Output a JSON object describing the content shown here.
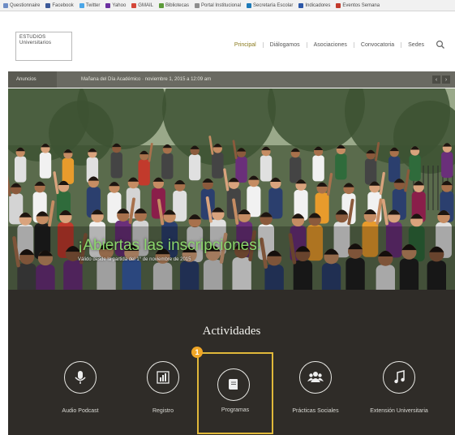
{
  "bookmarks": [
    {
      "label": "Questionnaire",
      "color": "#6d8cc4"
    },
    {
      "label": "Facebook",
      "color": "#3b5998"
    },
    {
      "label": "Twitter",
      "color": "#4aa6e8"
    },
    {
      "label": "Yahoo",
      "color": "#6b2fa0"
    },
    {
      "label": "GMAIL",
      "color": "#d44638"
    },
    {
      "label": "Bibliotecas",
      "color": "#5c9b3a"
    },
    {
      "label": "Portal Institucional",
      "color": "#8e8e8e"
    },
    {
      "label": "Secretaría Escolar",
      "color": "#1d7ab8"
    },
    {
      "label": "Indicadores",
      "color": "#2d58a8"
    },
    {
      "label": "Eventos Semana",
      "color": "#c23a2c"
    }
  ],
  "header": {
    "logo_line1": "ESTUDIOS",
    "logo_line2": "Universitarios",
    "nav": [
      "Principal",
      "Diálogamos",
      "Asociaciones",
      "Convocatoria",
      "Sedes"
    ],
    "active_color": "#8a7a1c"
  },
  "ticker": {
    "label": "Anuncios",
    "text": "Mañana del Día Académico · noviembre 1, 2015 a 12:09 am",
    "prev": "‹",
    "next": "›"
  },
  "hero": {
    "headline": "¡Abiertas las inscripciones!",
    "subtext": "Válido desde la partida del 1° de noviembre de 2015"
  },
  "activities": {
    "title": "Actividades",
    "marker_number": "1",
    "tiles": [
      {
        "label": "Audio Podcast",
        "icon": "microphone-icon"
      },
      {
        "label": "Registro",
        "icon": "bar-chart-icon"
      },
      {
        "label": "Programas",
        "icon": "book-icon",
        "selected": true
      },
      {
        "label": "Prácticas Sociales",
        "icon": "users-icon"
      },
      {
        "label": "Extensión Universitaria",
        "icon": "music-icon"
      }
    ],
    "highlight_color": "#e0b83a"
  }
}
